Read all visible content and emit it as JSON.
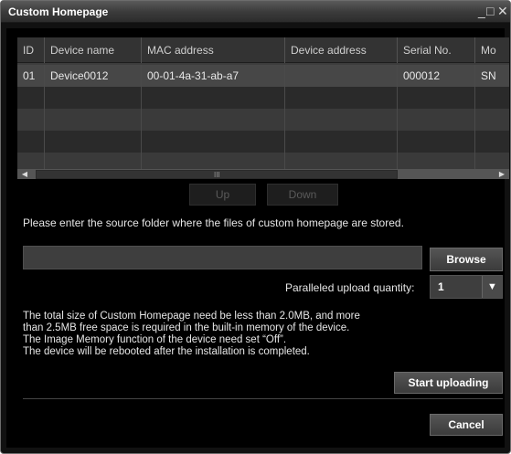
{
  "window": {
    "title": "Custom Homepage",
    "minimize_glyph": "_",
    "maximize_glyph": "□",
    "close_glyph": "✕"
  },
  "table": {
    "headers": [
      "ID",
      "Device name",
      "MAC address",
      "Device address",
      "Serial No.",
      "Mo"
    ],
    "rows": [
      [
        "01",
        "Device0012",
        "00-01-4a-31-ab-a7",
        "",
        "000012",
        "SN"
      ]
    ],
    "scroll_grip": "III"
  },
  "buttons": {
    "up": "Up",
    "down": "Down",
    "browse": "Browse",
    "start": "Start uploading",
    "cancel": "Cancel"
  },
  "source_prompt": "Please enter the source folder where the files of custom homepage are stored.",
  "source_path": "",
  "upload_quantity": {
    "label": "Paralleled upload quantity:",
    "value": "1"
  },
  "info_lines": [
    "The total size of Custom Homepage need be less than 2.0MB, and more",
    "than 2.5MB free space is required in the built-in memory of the device.",
    "The Image Memory function of the device need set “Off”.",
    "The device will be rebooted after the installation is completed."
  ]
}
